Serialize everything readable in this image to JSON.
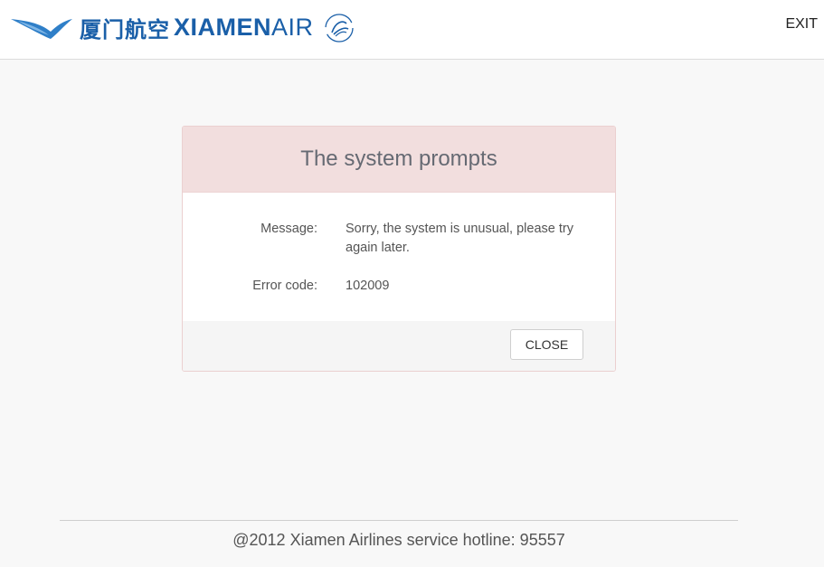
{
  "header": {
    "logo_cn": "厦门航空",
    "logo_en_bold": "XIAMEN",
    "logo_en_light": "AIR",
    "exit_label": "EXIT"
  },
  "dialog": {
    "title": "The system prompts",
    "message_label": "Message:",
    "message_value": "Sorry, the system is unusual, please try again later.",
    "error_label": "Error code:",
    "error_value": "102009",
    "close_label": "CLOSE"
  },
  "footer": {
    "text": "@2012 Xiamen Airlines service hotline: 95557"
  },
  "colors": {
    "brand": "#1a5fa8",
    "alert_header": "#f2dede",
    "footer_bg": "#f5f5f5"
  },
  "icons": {
    "logo": "egret-bird-logo",
    "alliance": "skyteam-icon"
  }
}
